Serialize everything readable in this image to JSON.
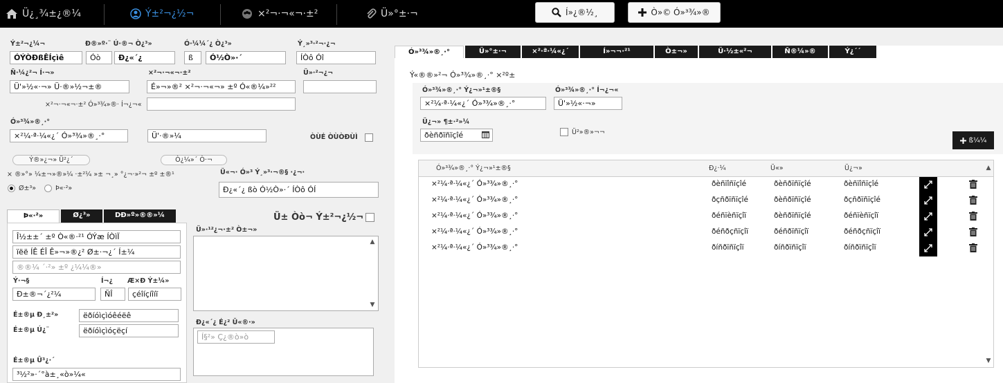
{
  "colors": {
    "topbar": "#000000",
    "active_nav": "#3a8fe0",
    "panel": "#f0f0f0"
  },
  "nav": {
    "items": [
      {
        "label": "Ü¿­¸¾±¿®¼",
        "icon": "home-icon"
      },
      {
        "label": "Ý±²¬¿½¬",
        "icon": "user-icon",
        "active": true
      },
      {
        "label": "×²­¬·¬«¬·±²­",
        "icon": "group-icon"
      },
      {
        "label": "Ü»°±­·¬­",
        "icon": "paperclip-icon"
      }
    ],
    "search_button": "Í»¿®½¸",
    "add_button": "Ò»© Ó»³¾»®"
  },
  "left": {
    "labels": {
      "title": "Ý±²¬¿¼¬",
      "first_name": "Ð®»º·¨   Ú·®­¬ Ò¿³»",
      "middle": "Ó·¼¼´¿ Ò¿³»",
      "last": "Ý¸»³·²¬·¿¬",
      "phone_type": "Ñ­­·¼¿²¬ Í·¬»",
      "institution": "×²­¬·¬«¬·±²",
      "other": "Ü»­·²¬¿¬",
      "inst_other": "×²­¬·¬«¬·±² Ó»³¾»®·   Í¬¿¬«­",
      "member_type": "Ó»³¾»®­¸·°",
      "spouse_flag": "ÒÙÉ ÒÙÒÐÙÌ",
      "relationship": "×   ®»°»­ ¼±¬»®»¼ ·±²¼ »± ¬¸» °¿¬·»²¬ ±º ±®¹",
      "relationship_detail": "Ü«¬· Ó»³ Ý¸»³·­¬®§ ·¿¬·­"
    },
    "values": {
      "title": "ÓÝÒÐßÊÍçìê",
      "prefix": "Ó­ò",
      "first": "Ð¿«´¿",
      "middle": "ß",
      "last": "Ó½Ò»·´",
      "phone_type": "ÍÒô Óî",
      "site": "Ü'»½«·¬» Ü·®»½¬±®",
      "institution": "É»¬»®² ×²­¬·¬«¬» ±º Ó«®¼»²²",
      "other": "",
      "inst_other": "",
      "member_type": "×²¼·ª·¼«¿´ Ó»³¾»®­¸·°",
      "member_type2": "Ü'·­®»¼",
      "relationship_detail": "Ð¿«´¿ ßò Ó½Ò»·´ ÍÒô ÓÍ"
    },
    "pills": [
      "Ý®»¿¬» Ü²¿´",
      "Ò¿¼»´ Ò·¬"
    ],
    "radios": [
      "Ø±³»",
      "Þ«­·²»­­"
    ],
    "tabs": [
      "Þ«­·²»­­",
      "Ø¿³»",
      "DÐ»º»®®»¼"
    ],
    "address": [
      "Î½±±´ ±º Ò«®­·²¹ ÓÝæ ÍÒìÏ",
      "ïëë ÍÊ ÉÎ Ê»¬»®¿² Ø±­·¬¿´ Í±¼",
      "®®¼ ´·²» ±º ¿¼¼®»­­"
    ],
    "city_label": "Ý·¬§",
    "state_label": "Í¬¿",
    "zip_label": "Æ×Ð Ý±¼»",
    "city": "Ð±®¬´¿²¼",
    "state": "ÑÎ",
    "zip": "çéîíçíîíï",
    "work_phone_label": "É±®µ Ð¸±²»",
    "work_phone": "ëðíóìçìóêéëê",
    "work_fax_label": "É±®µ Ú¿¨",
    "work_fax": "ëðíóìçìóçëçí",
    "work_email_label": "É±®µ Û³¿·´",
    "work_email": "³½²»·´°à±¸­«ò»¼«",
    "notes_check_label": "Ü± Òò¬ Ý±²¬¿½¬",
    "notes_label": "Ü»­·¹²¿¬·±² Ò±¬»­",
    "notes2_label": "Ð¿«´¿ É¿² Ü«®·»",
    "notes2_placeholder": "Í§²» Ç¿®ò»ò"
  },
  "right": {
    "tabs": [
      "Ó»³¾»®­¸·°",
      "Ü»°±­·¬­",
      "×²·ª·¼«¿´",
      "Í»¬¬·²¹­",
      "Ò±¬»­",
      "Ü·­½±«²¬­",
      "Ñ®¼»®­",
      "Ý¿´´­"
    ],
    "section_title": "Ý«®®»²¬ Ó»³¾»®­¸·° ×²º±",
    "label_member_type": "Ó»³¾»®­¸·°   Ý¿¬»¹±®§",
    "label_status": "Ó»³¾»®­¸·°   Í¬¿¬«­",
    "member_type": "×²¼·ª·¼«¿´ Ó»³¾»®­¸·°",
    "status": "Ü'»½«·¬»",
    "label_date": "Ü¿¬» ¶±·²»¼",
    "date": "ðèñðïñïçîé",
    "checkbox_label": "Ü²»®»¬¬",
    "add_label": "ß¼¼",
    "table": {
      "headers": [
        "Ó»³¾»®­¸·°   Ý¿¬»¹±®§",
        "Ð¿·¼",
        "Ü«»",
        "Ü¿¬»"
      ],
      "rows": [
        [
          "×²¼·ª·¼«¿´ Ó»³¾»®­¸·°",
          "ðèñïîñïçîé",
          "ðèñðïñïçîé",
          "ðèñïîñïçîé"
        ],
        [
          "×²¼·ª·¼«¿´ Ó»³¾»®­¸·°",
          "ðçñðïñïçîé",
          "ðèñðïñïçîé",
          "ðçñðïñïçîé"
        ],
        [
          "×²¼·ª·¼«¿´ Ó»³¾»®­¸·°",
          "ðéñïèñïçîï",
          "ðèñðïñïçîé",
          "ðéñïèñïçîï"
        ],
        [
          "×²¼·ª·¼«¿´ Ó»³¾»®­¸·°",
          "ðéñðçñïçîï",
          "ðéñðïñïçîï",
          "ðéñðçñïçîï"
        ],
        [
          "×²¼·ª·¼«¿´ Ó»³¾»®­¸·°",
          "ðíñðïñïçîï",
          "ðíñðïñïçîï",
          "ðíñðïñïçîï"
        ]
      ]
    }
  }
}
